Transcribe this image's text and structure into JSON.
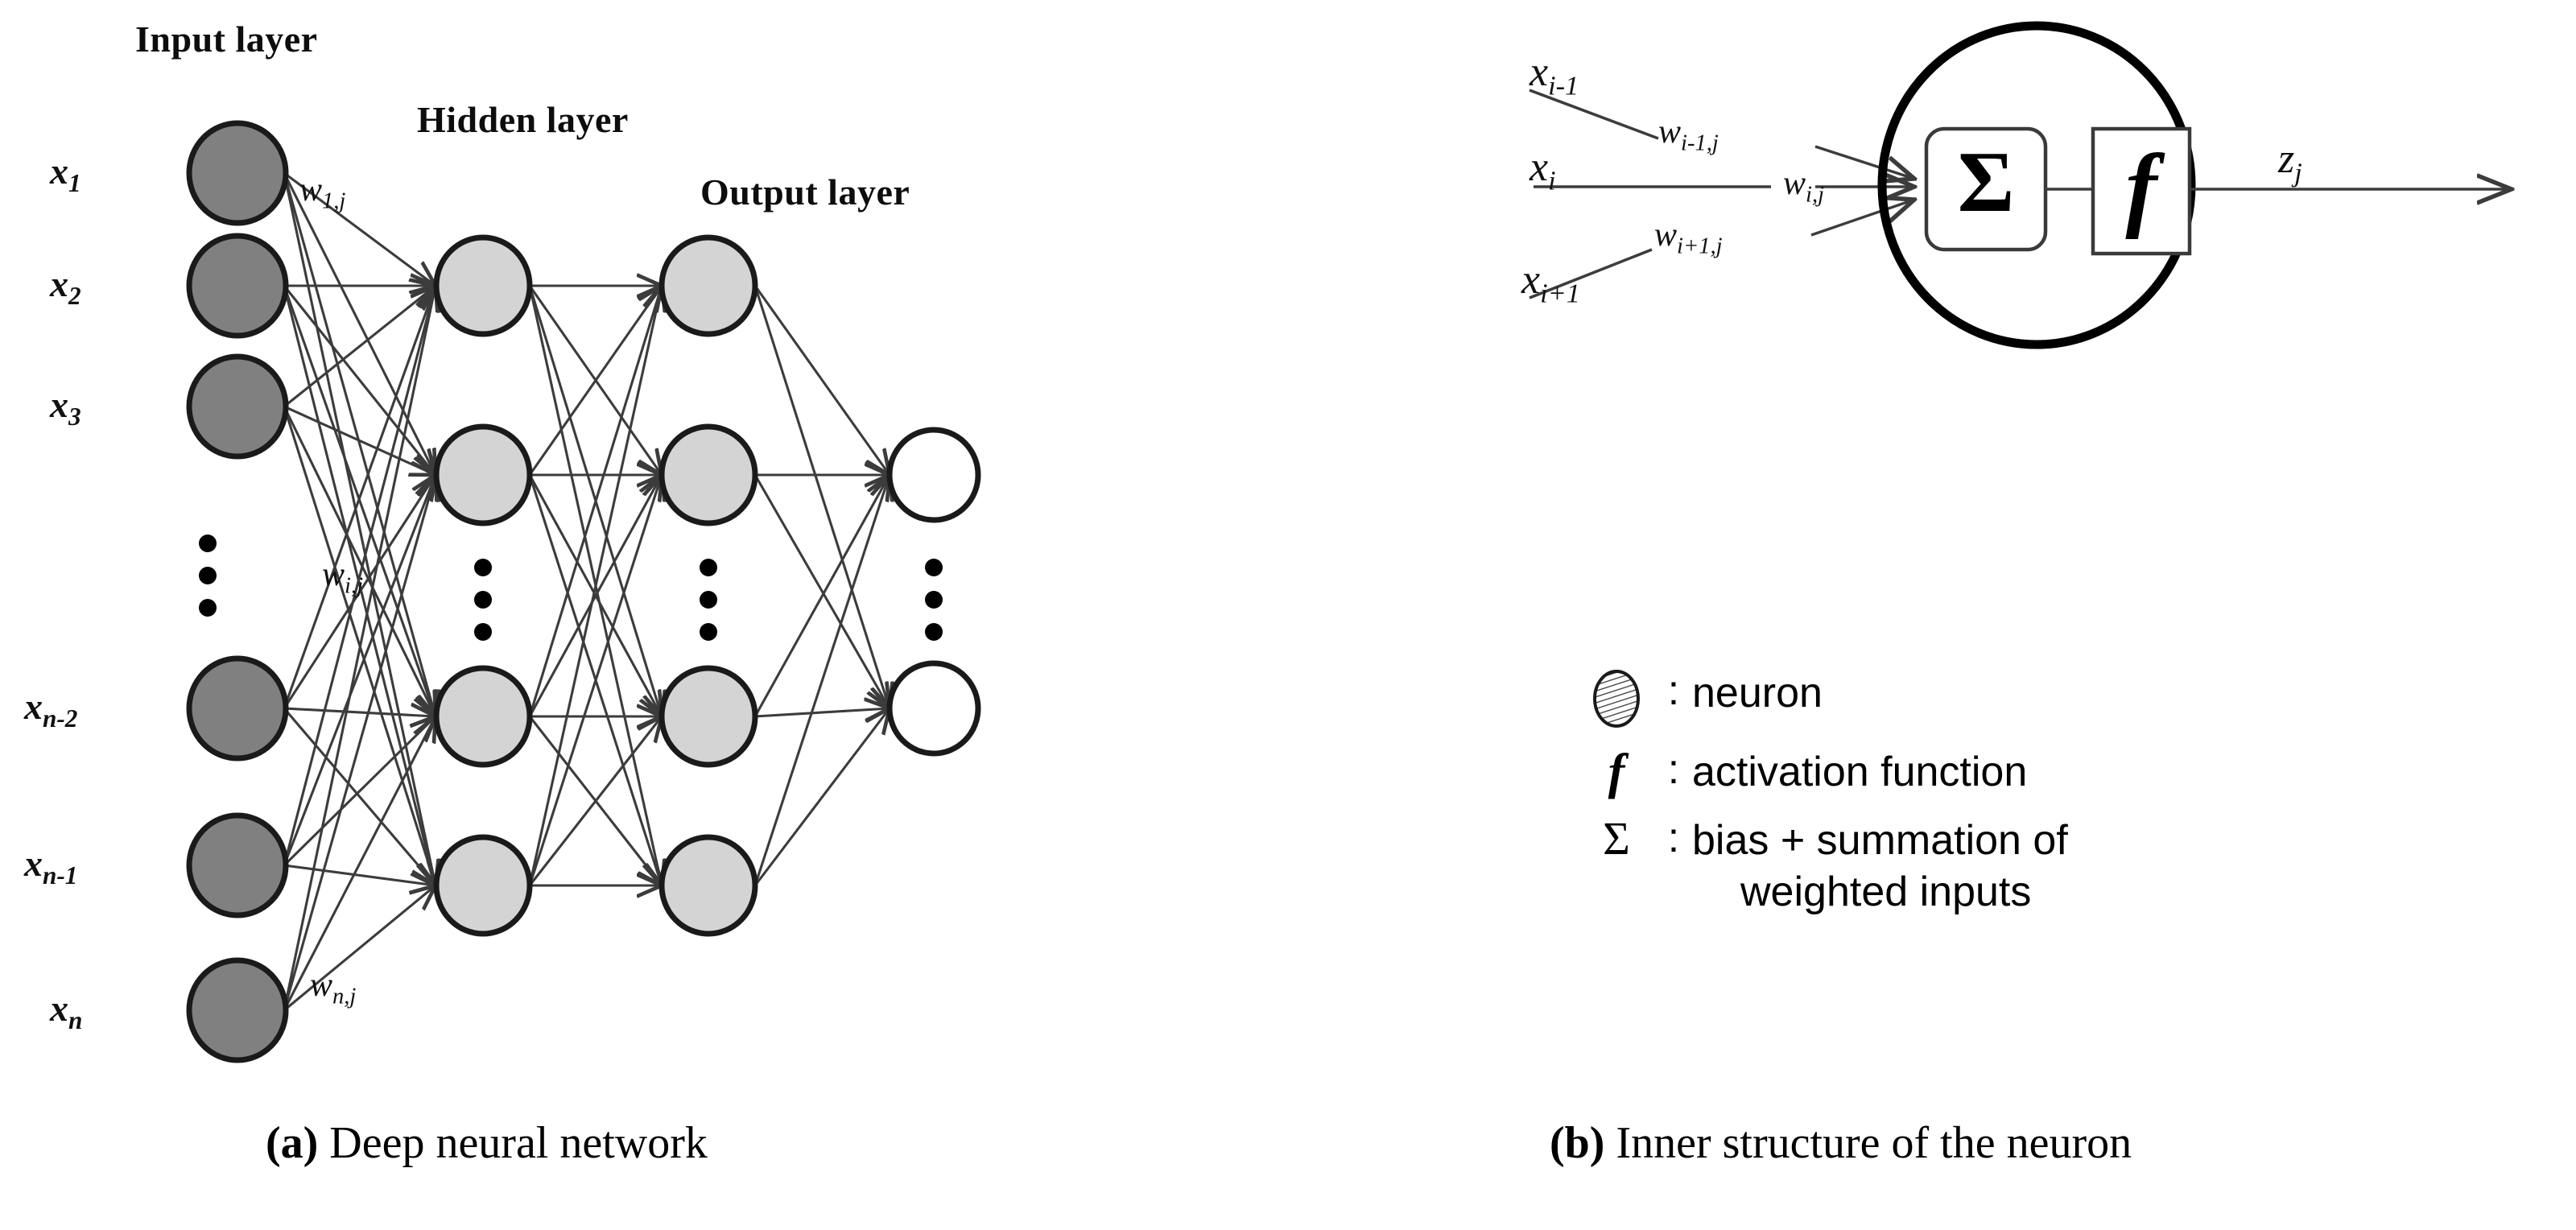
{
  "figure": {
    "panels": [
      {
        "id": "a",
        "caption_marker": "(a)",
        "caption_text": " Deep neural network",
        "layer_titles": {
          "input": "Input layer",
          "hidden": "Hidden layer",
          "output": "Output layer"
        },
        "input_labels": [
          "x1",
          "x2",
          "x3",
          "xn-2",
          "xn-1",
          "xn"
        ],
        "input_labels_rendered": [
          {
            "base": "x",
            "sub": "1"
          },
          {
            "base": "x",
            "sub": "2"
          },
          {
            "base": "x",
            "sub": "3"
          },
          {
            "base": "x",
            "sub": "n-2"
          },
          {
            "base": "x",
            "sub": "n-1"
          },
          {
            "base": "x",
            "sub": "n"
          }
        ],
        "weight_labels": [
          {
            "base": "w",
            "sub": "1,j"
          },
          {
            "base": "w",
            "sub": "i,j"
          },
          {
            "base": "w",
            "sub": "n,j"
          }
        ],
        "ellipsis_glyph": "⋮",
        "node_counts": {
          "input": 6,
          "hidden1": 4,
          "hidden2": 4,
          "output": 2
        },
        "node_colors": {
          "input": "#808080",
          "hidden": "#d4d4d4",
          "output": "#ffffff",
          "stroke": "#1a1a1a",
          "edge": "#3c3c3c"
        }
      },
      {
        "id": "b",
        "caption_marker": "(b)",
        "caption_text": " Inner structure of the neuron",
        "input_labels": [
          {
            "base": "x",
            "sub": "i-1"
          },
          {
            "base": "x",
            "sub": "i"
          },
          {
            "base": "x",
            "sub": "i+1"
          }
        ],
        "weight_labels": [
          {
            "base": "w",
            "sub": "i-1,j"
          },
          {
            "base": "w",
            "sub": "i,j"
          },
          {
            "base": "w",
            "sub": "i+1,j"
          }
        ],
        "output_label": {
          "base": "z",
          "sub": "j"
        },
        "box_symbols": {
          "sum": "Σ",
          "activation": "f"
        },
        "legend": [
          {
            "symbol": "neuron-hatched-circle",
            "sep": ":",
            "lines": [
              "neuron"
            ]
          },
          {
            "symbol": "f",
            "sep": ":",
            "lines": [
              "activation function"
            ]
          },
          {
            "symbol": "Σ",
            "sep": ":",
            "lines": [
              "bias + summation of",
              "weighted inputs"
            ]
          }
        ]
      }
    ]
  }
}
